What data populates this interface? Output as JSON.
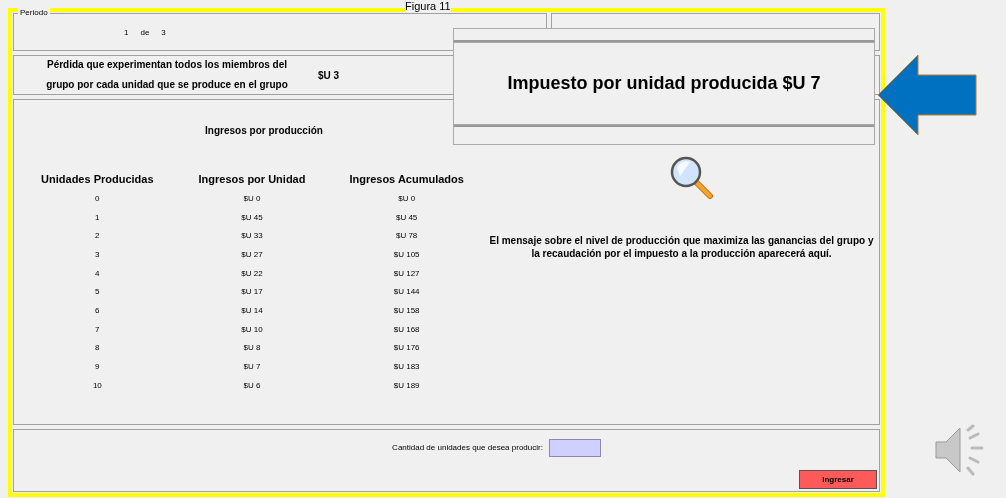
{
  "caption": "Figura 11",
  "period": {
    "legend": "Periodo",
    "current": "1",
    "word": "de",
    "total": "3"
  },
  "loss": {
    "label": "Pérdida que experimentan todos los miembros del grupo por cada unidad que se produce en el grupo",
    "value": "$U 3"
  },
  "popup": {
    "text": "Impuesto por unidad producida $U 7"
  },
  "income": {
    "title": "Ingresos por producción",
    "columns": [
      "Unidades Producidas",
      "Ingresos por Unidad",
      "Ingresos Acumulados"
    ],
    "rows": [
      [
        "0",
        "$U 0",
        "$U 0"
      ],
      [
        "1",
        "$U 45",
        "$U 45"
      ],
      [
        "2",
        "$U 33",
        "$U 78"
      ],
      [
        "3",
        "$U 27",
        "$U 105"
      ],
      [
        "4",
        "$U 22",
        "$U 127"
      ],
      [
        "5",
        "$U 17",
        "$U 144"
      ],
      [
        "6",
        "$U 14",
        "$U 158"
      ],
      [
        "7",
        "$U 10",
        "$U 168"
      ],
      [
        "8",
        "$U 8",
        "$U 176"
      ],
      [
        "9",
        "$U 7",
        "$U 183"
      ],
      [
        "10",
        "$U 6",
        "$U 189"
      ]
    ]
  },
  "message": "El mensaje sobre el nivel de producción que maximiza las ganancias del grupo y la recaudación por el impuesto a la producción aparecerá aquí.",
  "input": {
    "label": "Cantidad de unidades que desea producir:"
  },
  "submit": {
    "label": "Ingresar"
  }
}
